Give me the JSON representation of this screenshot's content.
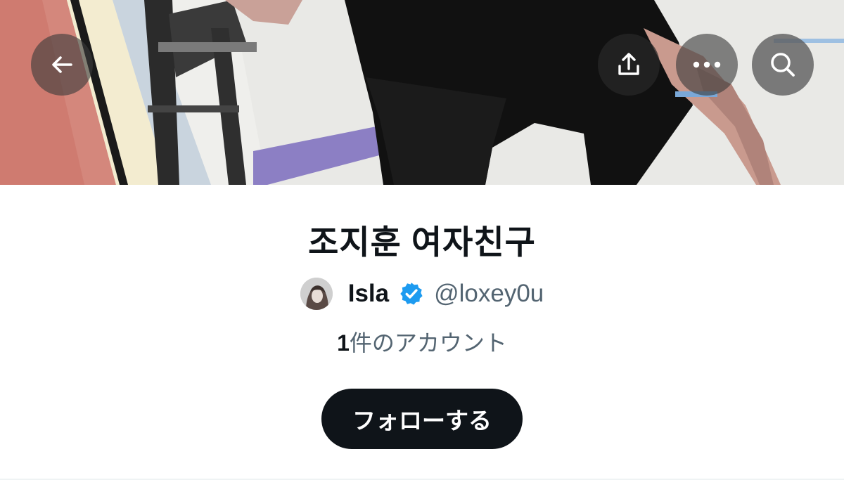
{
  "header": {
    "back_icon": "arrow-left-icon",
    "share_icon": "share-upload-icon",
    "more_icon": "ellipsis-icon",
    "search_icon": "search-icon"
  },
  "list": {
    "title": "조지훈 여자친구",
    "owner": {
      "name": "Isla",
      "handle": "@loxey0u",
      "verified": true
    },
    "members": {
      "count": "1",
      "label": "件のアカウント"
    },
    "follow_label": "フォローする"
  },
  "colors": {
    "text_primary": "#0f1419",
    "text_secondary": "#536471",
    "verified_blue": "#1d9bf0",
    "button_dark": "#0f1419"
  }
}
